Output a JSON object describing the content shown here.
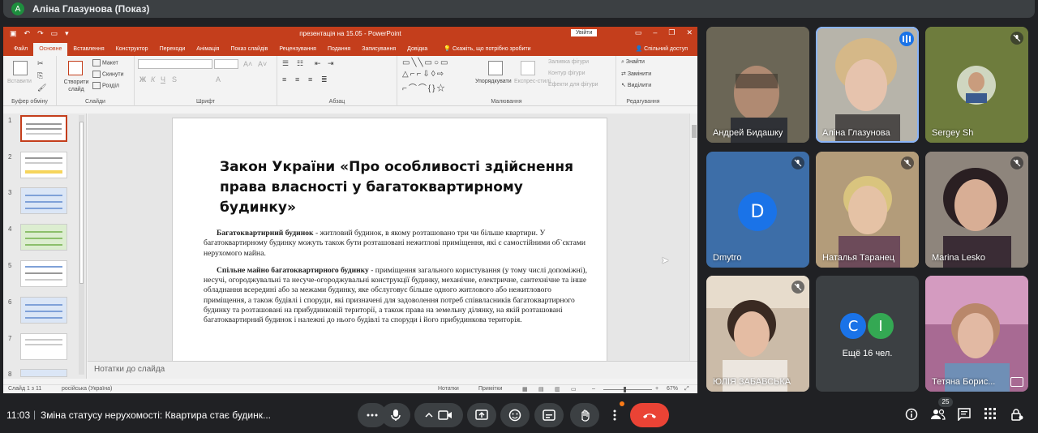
{
  "presenter": {
    "avatar_letter": "A",
    "label": "Аліна Глазунова (Показ)"
  },
  "powerpoint": {
    "doc_title": "презентація на 15.05 - PowerPoint",
    "sign_in": "Увійти",
    "tabs": [
      "Файл",
      "Основне",
      "Вставлення",
      "Конструктор",
      "Переходи",
      "Анімація",
      "Показ слайдів",
      "Рецензування",
      "Подання",
      "Записування",
      "Довідка"
    ],
    "active_tab": "Основне",
    "tell_me": "Скажіть, що потрібно зробити",
    "share": "Спільний доступ",
    "ribbon": {
      "clipboard": {
        "paste": "Вставити",
        "label": "Буфер обміну"
      },
      "slides": {
        "new_slide": "Створити слайд",
        "layout": "Макет",
        "reset": "Скинути",
        "section": "Розділ",
        "label": "Слайди"
      },
      "font": {
        "label": "Шрифт"
      },
      "paragraph": {
        "label": "Абзац"
      },
      "drawing": {
        "arrange": "Упорядкувати",
        "quick_styles": "Експрес-стилі",
        "fill": "Заливка фігури",
        "outline": "Контур фігури",
        "effects": "Ефекти для фігури",
        "label": "Малювання"
      },
      "editing": {
        "find": "Знайти",
        "replace": "Замінити",
        "select": "Виділити",
        "label": "Редагування"
      }
    },
    "thumbnails": [
      "1",
      "2",
      "3",
      "4",
      "5",
      "6",
      "7",
      "8"
    ],
    "selected_slide": 1,
    "slide": {
      "title": "Закон України «Про особливості здійснення права власності у багатоквартирному будинку»",
      "p1_term": "Багатоквартирний будинок",
      "p1_text": " - житловий будинок, в якому розташовано три чи більше квартири. У багатоквартирному будинку можуть також бути розташовані нежитлові приміщення, які є самостійними об`єктами нерухомого майна.",
      "p2_term": "Спільне майно багатоквартирного будинку",
      "p2_text": " - приміщення загального користування (у тому числі допоміжні), несучі, огороджувальні та несуче-огороджувальні конструкції будинку, механічне, електричне, сантехнічне та інше обладнання всередині або за межами будинку, яке обслуговує більше одного житлового або нежитлового приміщення, а також будівлі і споруди, які призначені для задоволення потреб співвласників багатоквартирного будинку та розташовані на прибудинковій території, а також права на земельну ділянку, на якій розташовані багатоквартирний будинок і належні до нього будівлі та споруди і його прибудинкова територія."
    },
    "notes_placeholder": "Нотатки до слайда",
    "status": {
      "slide_counter": "Слайд 1 з 11",
      "language": "російська (Україна)",
      "notes": "Нотатки",
      "comments": "Примітки",
      "zoom": "67%"
    }
  },
  "participants": [
    {
      "name": "Андрей Бидашку",
      "muted": false
    },
    {
      "name": "Аліна Глазунова",
      "muted": false,
      "speaking": true
    },
    {
      "name": "Sergey Sh",
      "muted": true
    },
    {
      "name": "Dmytro",
      "muted": true,
      "avatar_letter": "D",
      "avatar_color": "#1a73e8"
    },
    {
      "name": "Наталья Таранец",
      "muted": true
    },
    {
      "name": "Marina Lesko",
      "muted": true
    },
    {
      "name": "ЮЛІЯ ЗАБАВСЬКА",
      "muted": true
    },
    {
      "name": "Тетяна Борис...",
      "muted": false
    }
  ],
  "others": {
    "letters": [
      "C",
      "I"
    ],
    "colors": [
      "#1a73e8",
      "#34a853"
    ],
    "label": "Ещё 16 чел."
  },
  "bottom": {
    "time": "11:03",
    "separator": "|",
    "meeting_title": "Зміна статусу нерухомості: Квартира стає будинк...",
    "participant_count": "25",
    "accent_red": "#ea4335"
  }
}
